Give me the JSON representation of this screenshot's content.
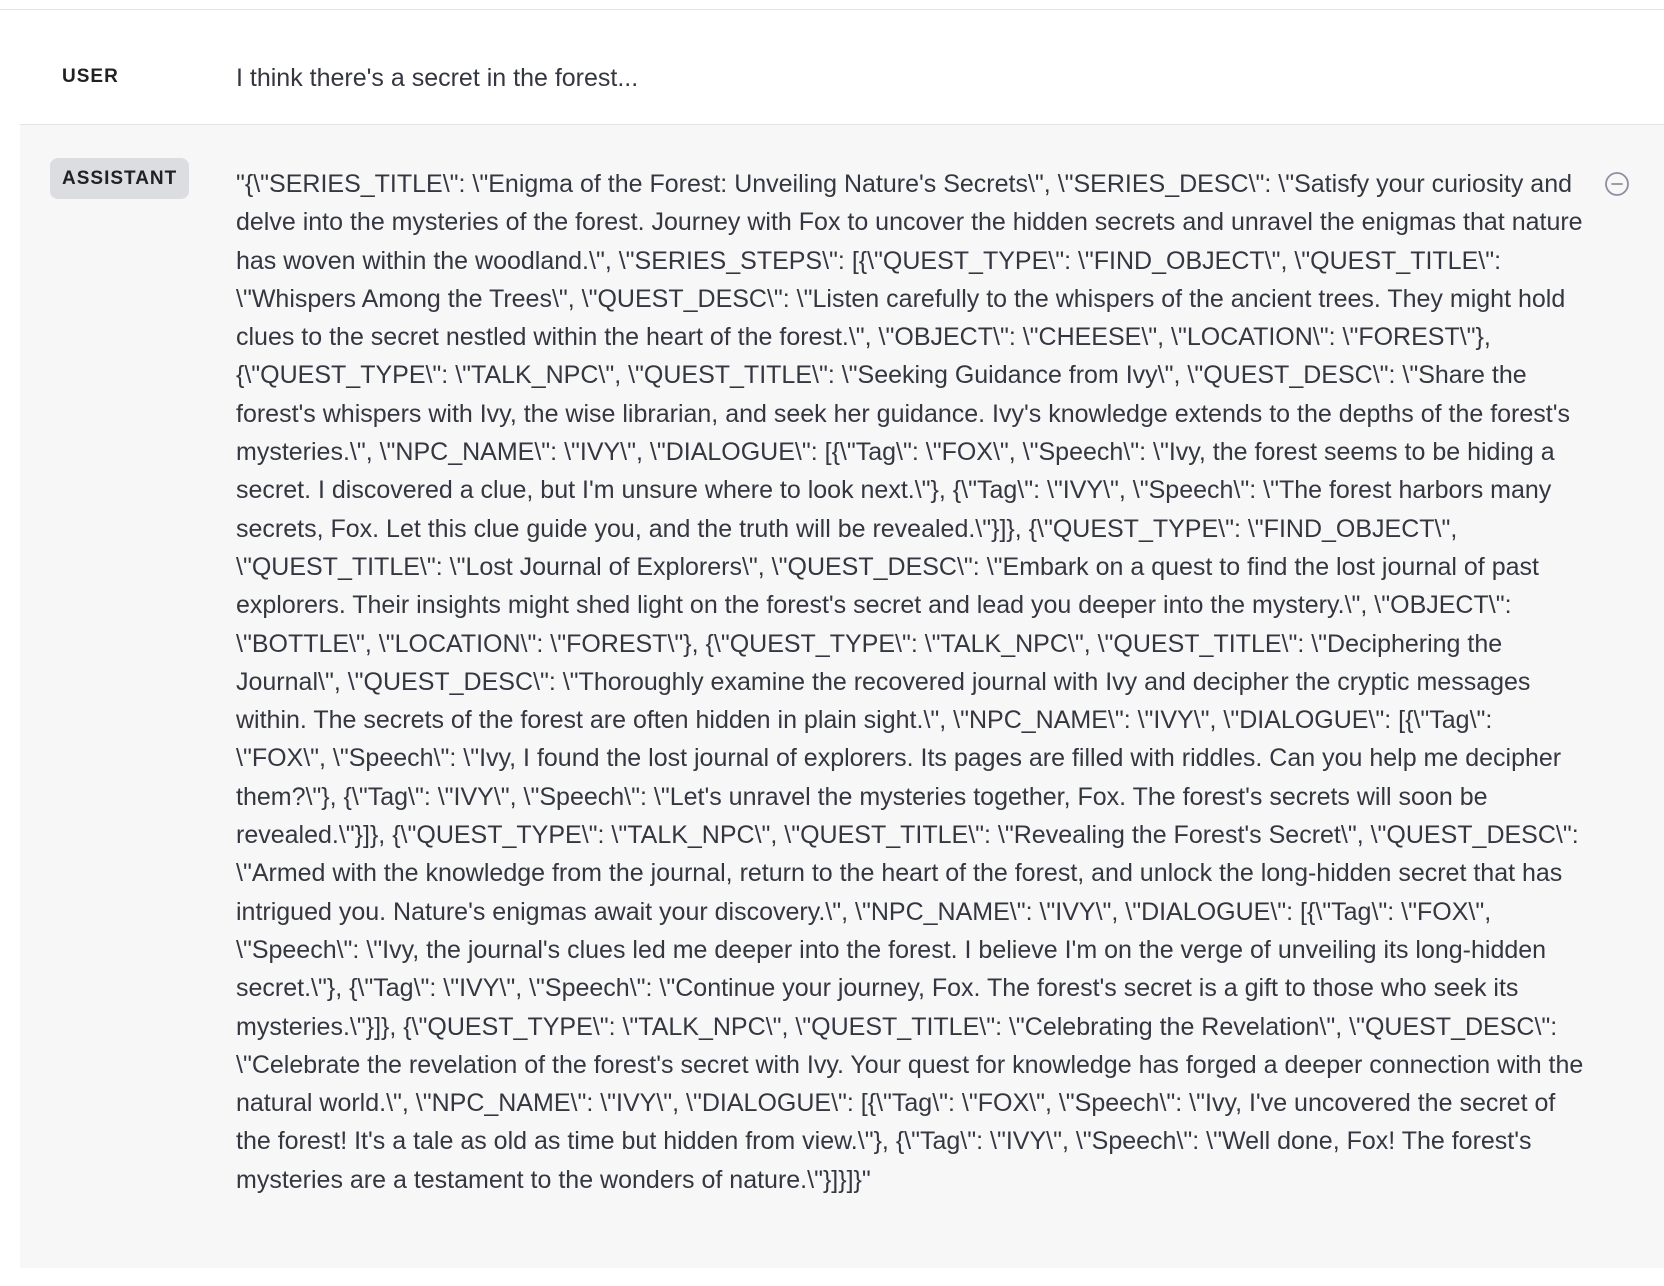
{
  "messages": {
    "user": {
      "role": "USER",
      "text": "I think there's a secret in the forest..."
    },
    "assistant": {
      "role": "ASSISTANT",
      "text": "\"{\\\"SERIES_TITLE\\\": \\\"Enigma of the Forest: Unveiling Nature's Secrets\\\", \\\"SERIES_DESC\\\": \\\"Satisfy your curiosity and delve into the mysteries of the forest. Journey with Fox to uncover the hidden secrets and unravel the enigmas that nature has woven within the woodland.\\\", \\\"SERIES_STEPS\\\": [{\\\"QUEST_TYPE\\\": \\\"FIND_OBJECT\\\", \\\"QUEST_TITLE\\\": \\\"Whispers Among the Trees\\\", \\\"QUEST_DESC\\\": \\\"Listen carefully to the whispers of the ancient trees. They might hold clues to the secret nestled within the heart of the forest.\\\", \\\"OBJECT\\\": \\\"CHEESE\\\", \\\"LOCATION\\\": \\\"FOREST\\\"}, {\\\"QUEST_TYPE\\\": \\\"TALK_NPC\\\", \\\"QUEST_TITLE\\\": \\\"Seeking Guidance from Ivy\\\", \\\"QUEST_DESC\\\": \\\"Share the forest's whispers with Ivy, the wise librarian, and seek her guidance. Ivy's knowledge extends to the depths of the forest's mysteries.\\\", \\\"NPC_NAME\\\": \\\"IVY\\\", \\\"DIALOGUE\\\": [{\\\"Tag\\\": \\\"FOX\\\", \\\"Speech\\\": \\\"Ivy, the forest seems to be hiding a secret. I discovered a clue, but I'm unsure where to look next.\\\"}, {\\\"Tag\\\": \\\"IVY\\\", \\\"Speech\\\": \\\"The forest harbors many secrets, Fox. Let this clue guide you, and the truth will be revealed.\\\"}]}, {\\\"QUEST_TYPE\\\": \\\"FIND_OBJECT\\\", \\\"QUEST_TITLE\\\": \\\"Lost Journal of Explorers\\\", \\\"QUEST_DESC\\\": \\\"Embark on a quest to find the lost journal of past explorers. Their insights might shed light on the forest's secret and lead you deeper into the mystery.\\\", \\\"OBJECT\\\": \\\"BOTTLE\\\", \\\"LOCATION\\\": \\\"FOREST\\\"}, {\\\"QUEST_TYPE\\\": \\\"TALK_NPC\\\", \\\"QUEST_TITLE\\\": \\\"Deciphering the Journal\\\", \\\"QUEST_DESC\\\": \\\"Thoroughly examine the recovered journal with Ivy and decipher the cryptic messages within. The secrets of the forest are often hidden in plain sight.\\\", \\\"NPC_NAME\\\": \\\"IVY\\\", \\\"DIALOGUE\\\": [{\\\"Tag\\\": \\\"FOX\\\", \\\"Speech\\\": \\\"Ivy, I found the lost journal of explorers. Its pages are filled with riddles. Can you help me decipher them?\\\"}, {\\\"Tag\\\": \\\"IVY\\\", \\\"Speech\\\": \\\"Let's unravel the mysteries together, Fox. The forest's secrets will soon be revealed.\\\"}]}, {\\\"QUEST_TYPE\\\": \\\"TALK_NPC\\\", \\\"QUEST_TITLE\\\": \\\"Revealing the Forest's Secret\\\", \\\"QUEST_DESC\\\": \\\"Armed with the knowledge from the journal, return to the heart of the forest, and unlock the long-hidden secret that has intrigued you. Nature's enigmas await your discovery.\\\", \\\"NPC_NAME\\\": \\\"IVY\\\", \\\"DIALOGUE\\\": [{\\\"Tag\\\": \\\"FOX\\\", \\\"Speech\\\": \\\"Ivy, the journal's clues led me deeper into the forest. I believe I'm on the verge of unveiling its long-hidden secret.\\\"}, {\\\"Tag\\\": \\\"IVY\\\", \\\"Speech\\\": \\\"Continue your journey, Fox. The forest's secret is a gift to those who seek its mysteries.\\\"}]}, {\\\"QUEST_TYPE\\\": \\\"TALK_NPC\\\", \\\"QUEST_TITLE\\\": \\\"Celebrating the Revelation\\\", \\\"QUEST_DESC\\\": \\\"Celebrate the revelation of the forest's secret with Ivy. Your quest for knowledge has forged a deeper connection with the natural world.\\\", \\\"NPC_NAME\\\": \\\"IVY\\\", \\\"DIALOGUE\\\": [{\\\"Tag\\\": \\\"FOX\\\", \\\"Speech\\\": \\\"Ivy, I've uncovered the secret of the forest! It's a tale as old as time but hidden from view.\\\"}, {\\\"Tag\\\": \\\"IVY\\\", \\\"Speech\\\": \\\"Well done, Fox! The forest's mysteries are a testament to the wonders of nature.\\\"}]}]}\""
    }
  },
  "icons": {
    "remove_message": "minus-circle-icon"
  },
  "colors": {
    "user_row_background": "#ffffff",
    "assistant_row_background": "#f7f7f8",
    "assistant_tag_background": "#dcdde1",
    "text": "#353740",
    "divider": "#e3e3e6"
  }
}
